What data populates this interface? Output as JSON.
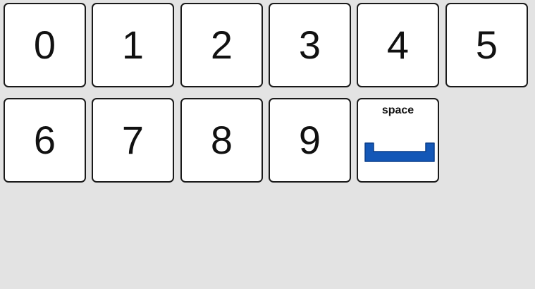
{
  "keyboard": {
    "keys": [
      {
        "label": "0"
      },
      {
        "label": "1"
      },
      {
        "label": "2"
      },
      {
        "label": "3"
      },
      {
        "label": "4"
      },
      {
        "label": "5"
      },
      {
        "label": "6"
      },
      {
        "label": "7"
      },
      {
        "label": "8"
      },
      {
        "label": "9"
      }
    ],
    "space_key": {
      "label": "space",
      "icon": "space-bar-icon",
      "icon_color": "#1357b7"
    }
  },
  "colors": {
    "background": "#e3e3e3",
    "key_fill": "#ffffff",
    "key_border": "#1a1a1a"
  }
}
